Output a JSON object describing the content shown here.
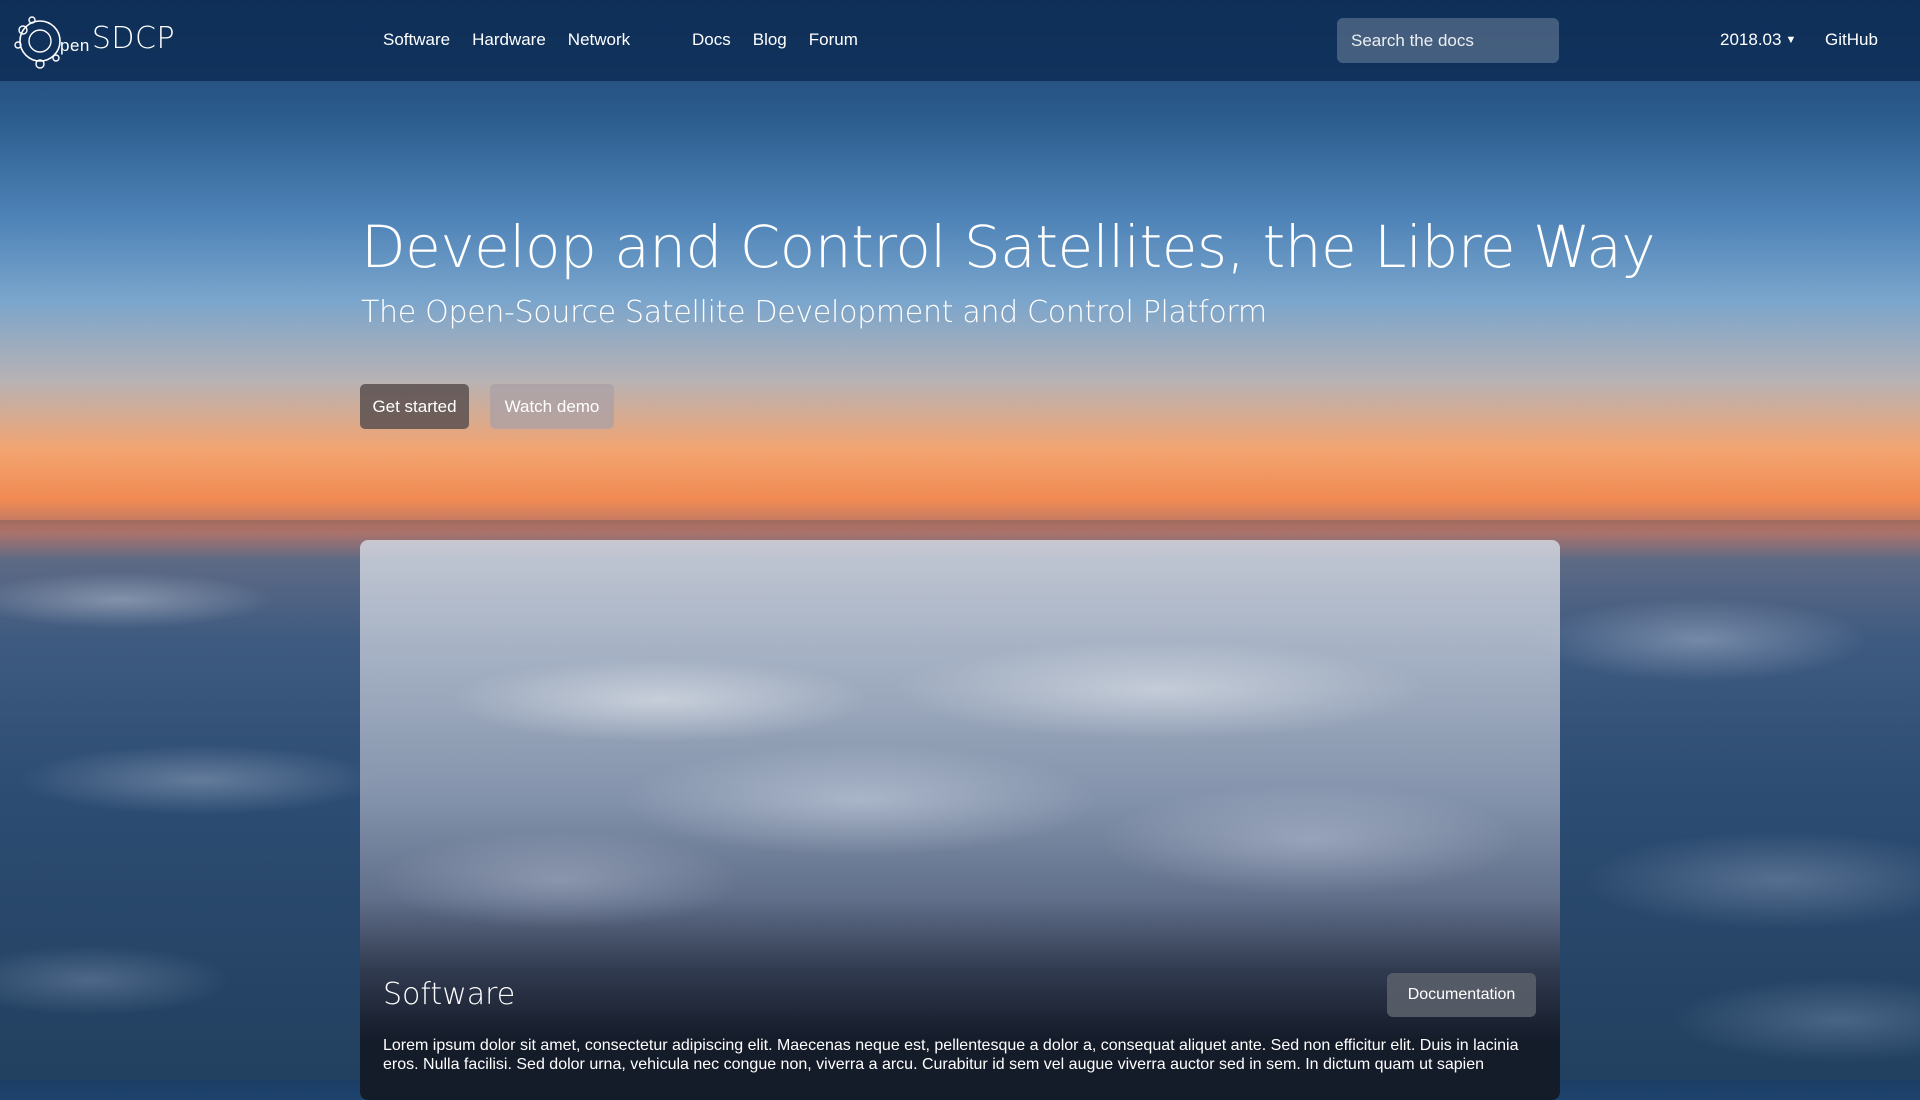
{
  "header": {
    "logo_small": "pen",
    "logo_name": "SDCP",
    "nav_left": [
      "Software",
      "Hardware",
      "Network"
    ],
    "nav_mid": [
      "Docs",
      "Blog",
      "Forum"
    ],
    "search_placeholder": "Search the docs",
    "version": "2018.03",
    "github": "GitHub"
  },
  "hero": {
    "title": "Develop and Control Satellites, the Libre Way",
    "subtitle": "The Open-Source Satellite Development and Control Platform",
    "primary_button": "Get started",
    "secondary_button": "Watch demo"
  },
  "card": {
    "title": "Software",
    "button": "Documentation",
    "text": "Lorem ipsum dolor sit amet, consectetur adipiscing elit. Maecenas neque est, pellentesque a dolor a, consequat aliquet ante. Sed non efficitur elit. Duis in lacinia eros. Nulla facilisi. Sed dolor urna, vehicula nec congue non, viverra a arcu. Curabitur id sem vel augue viverra auctor sed in sem. In dictum quam ut sapien"
  }
}
